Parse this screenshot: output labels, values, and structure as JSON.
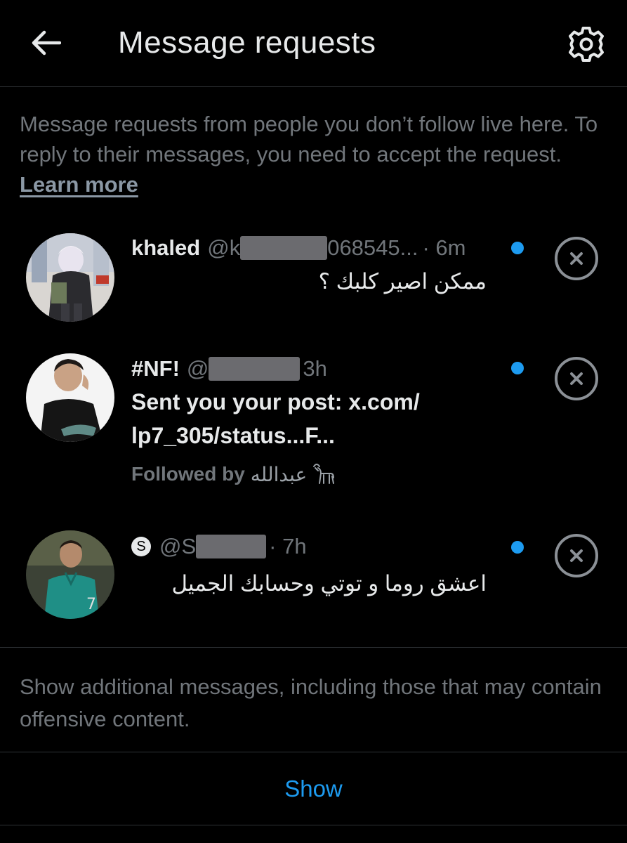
{
  "header": {
    "title": "Message requests",
    "back_icon": "arrow-left-icon",
    "settings_icon": "gear-icon"
  },
  "intro": {
    "text": "Message requests from people you don’t follow live here. To reply to their messages, you need to accept the request.",
    "link": "Learn more"
  },
  "requests": [
    {
      "name": "khaled",
      "handle_start": "@k",
      "handle_end": "068545...",
      "time": "· 6m",
      "message": "ممكن اصير كلبك ؟"
    },
    {
      "name": "#NF!",
      "handle_start": "@",
      "time": "3h",
      "message": "Sent you your post: x.com/ lp7_305/status...F...",
      "followed_by_label": "Followed by",
      "followed_by_name": "عبدالله"
    },
    {
      "badge": "S",
      "handle_start": "@S",
      "time": "· 7h",
      "message": "اعشق روما و توتي وحسابك الجميل"
    }
  ],
  "additional": {
    "text": "Show additional messages, including those that may contain offensive content.",
    "button": "Show"
  },
  "colors": {
    "background": "#000000",
    "text_primary": "#e7e9ea",
    "text_secondary": "#71767b",
    "accent": "#1d9bf0",
    "divider": "#2f3336"
  }
}
